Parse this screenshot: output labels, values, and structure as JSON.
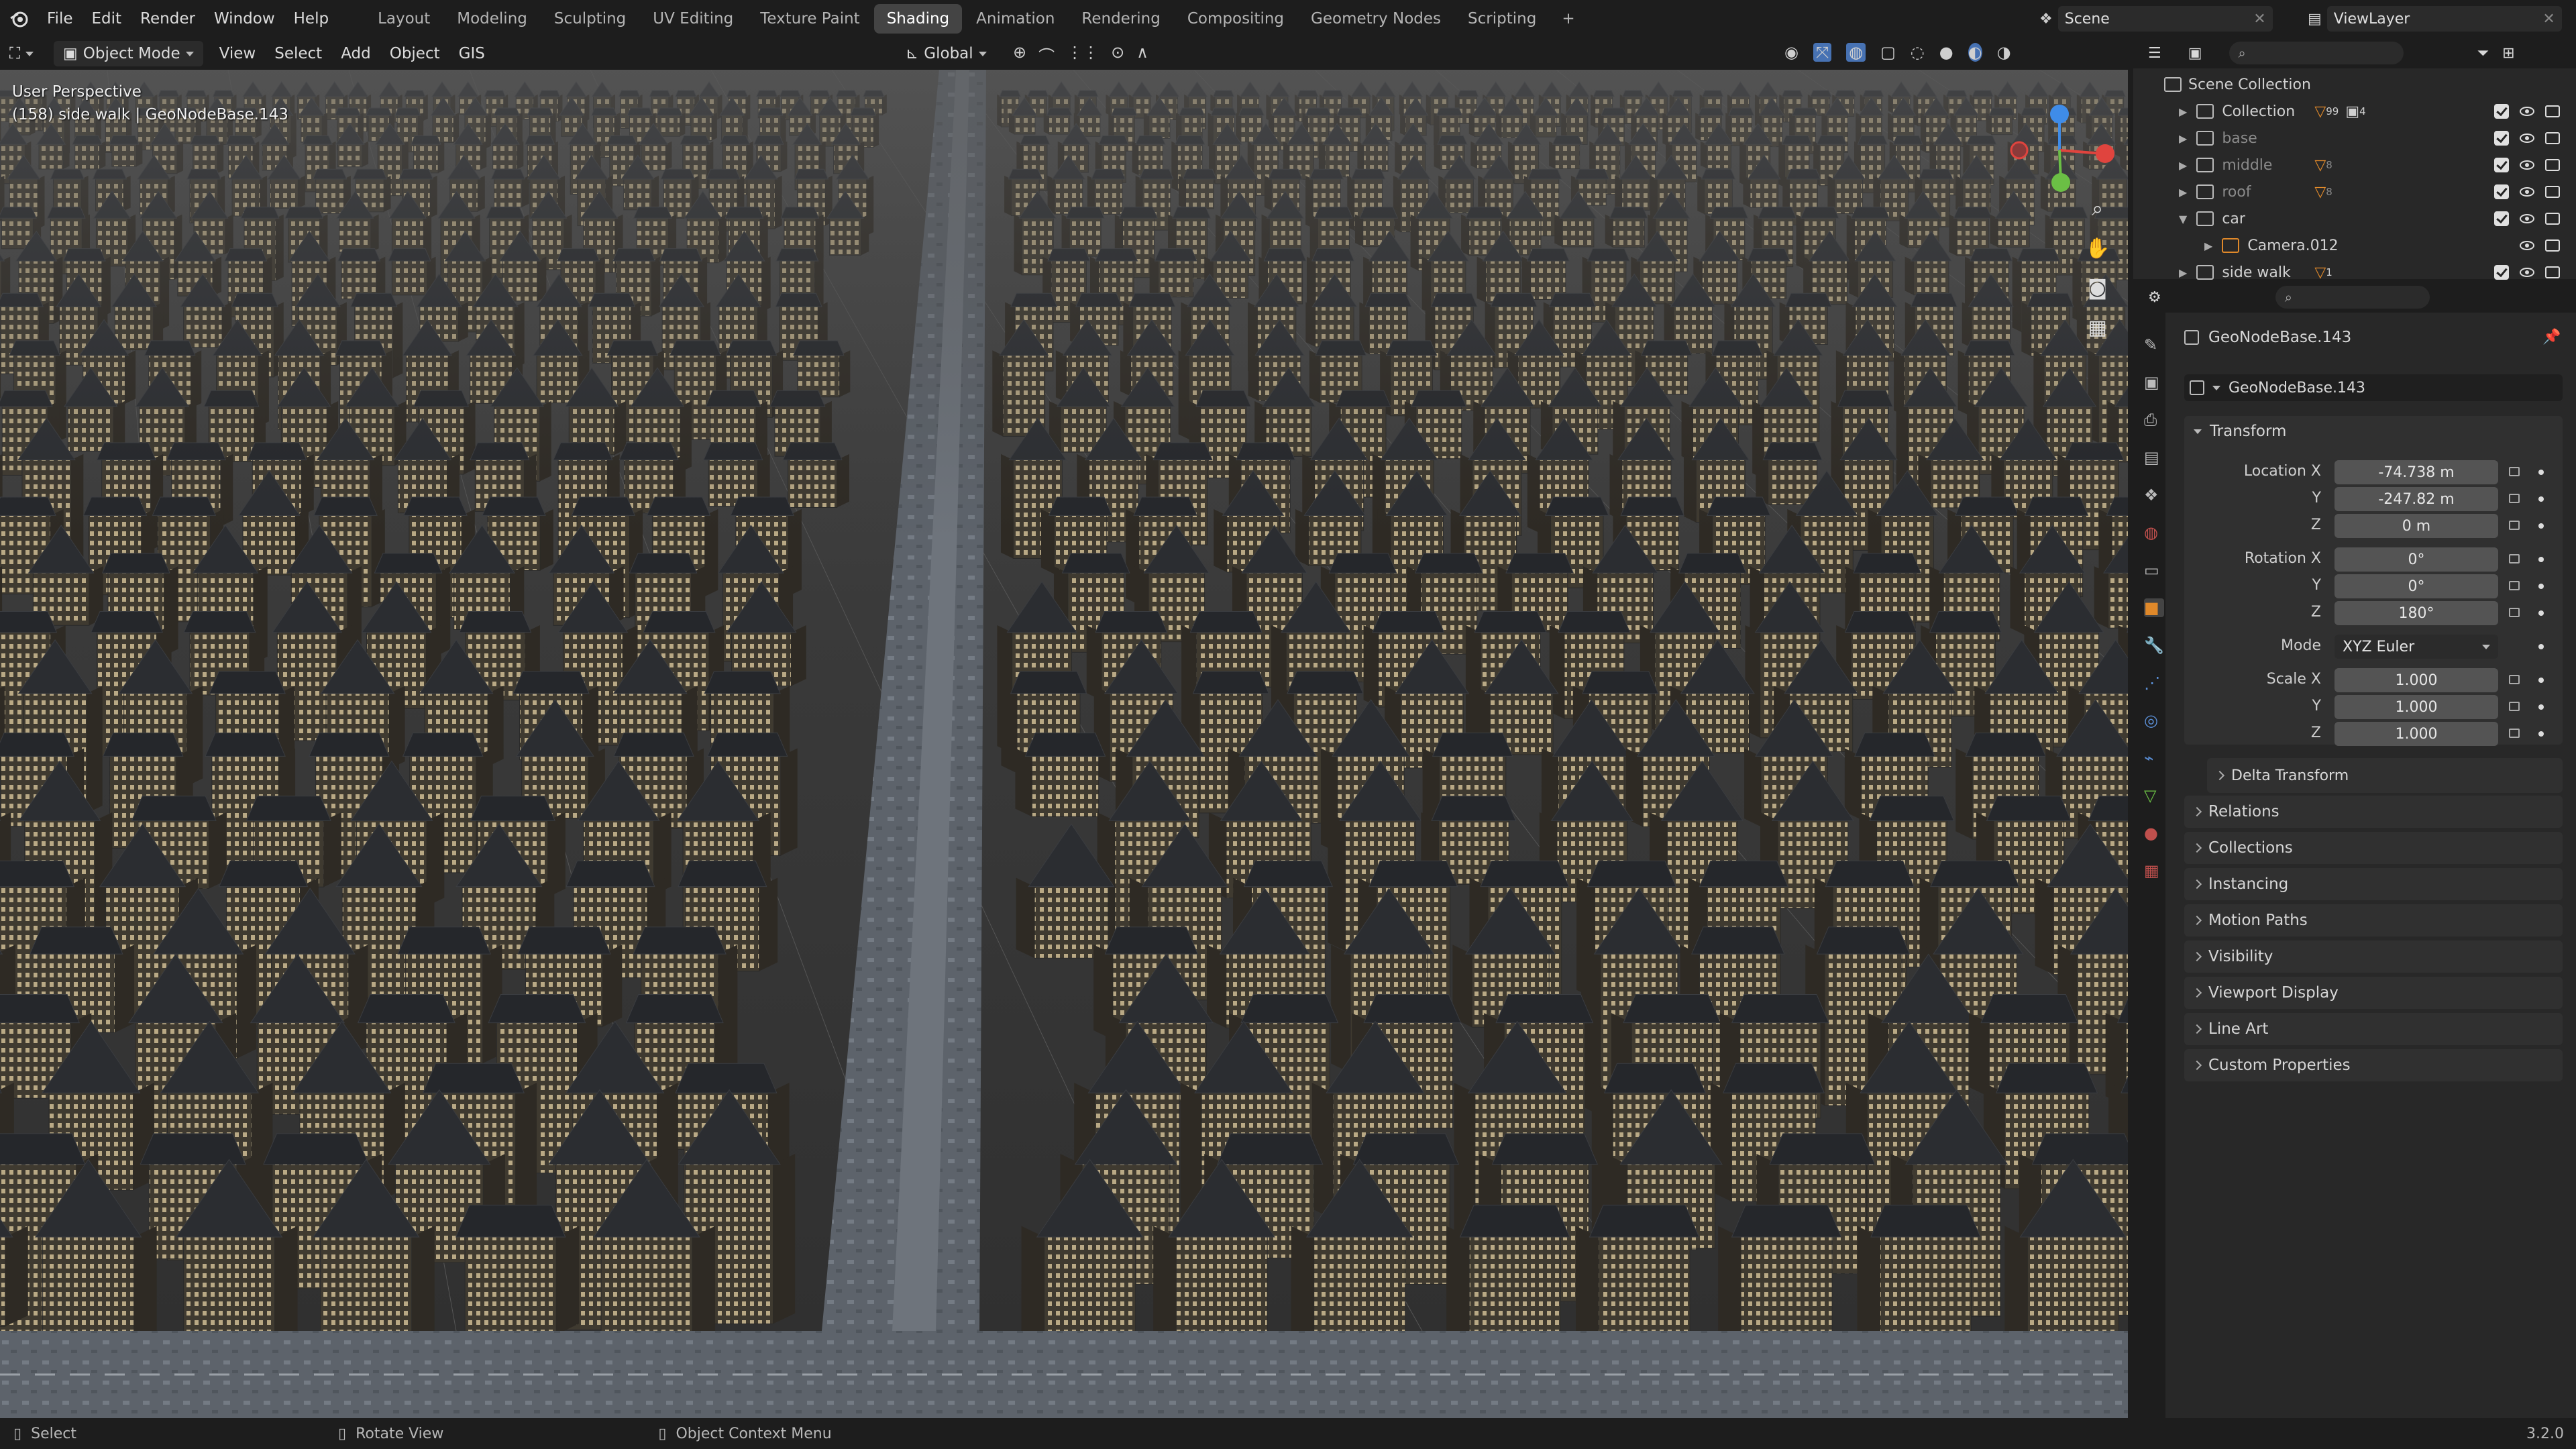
{
  "menu": [
    "File",
    "Edit",
    "Render",
    "Window",
    "Help"
  ],
  "workspaces": [
    {
      "label": "Layout",
      "active": false
    },
    {
      "label": "Modeling",
      "active": false
    },
    {
      "label": "Sculpting",
      "active": false
    },
    {
      "label": "UV Editing",
      "active": false
    },
    {
      "label": "Texture Paint",
      "active": false
    },
    {
      "label": "Shading",
      "active": true
    },
    {
      "label": "Animation",
      "active": false
    },
    {
      "label": "Rendering",
      "active": false
    },
    {
      "label": "Compositing",
      "active": false
    },
    {
      "label": "Geometry Nodes",
      "active": false
    },
    {
      "label": "Scripting",
      "active": false
    }
  ],
  "add_workspace": "+",
  "scene": {
    "name": "Scene",
    "view_layer": "ViewLayer"
  },
  "viewport_header": {
    "mode": "Object Mode",
    "menus": [
      "View",
      "Select",
      "Add",
      "Object",
      "GIS"
    ],
    "orientation": "Global"
  },
  "viewport": {
    "perspective": "User Perspective",
    "object_info": "(158) side walk | GeoNodeBase.143"
  },
  "outliner": {
    "root": "Scene Collection",
    "rows": [
      {
        "label": "Collection",
        "badge": "99",
        "badge2": "4",
        "visible": true
      },
      {
        "label": "base",
        "badge": "",
        "visible": false
      },
      {
        "label": "middle",
        "badge": "8",
        "visible": false
      },
      {
        "label": "roof",
        "badge": "8",
        "visible": false
      },
      {
        "label": "car",
        "badge": "",
        "visible": true
      },
      {
        "label": "Camera.012",
        "badge": "",
        "visible": true
      },
      {
        "label": "side walk",
        "badge": "1",
        "visible": true
      }
    ]
  },
  "properties": {
    "object_name": "GeoNodeBase.143",
    "data_name": "GeoNodeBase.143",
    "transform_label": "Transform",
    "location": {
      "label": "Location X",
      "x": "-74.738 m",
      "y": "-247.82 m",
      "z": "0 m"
    },
    "rotation": {
      "label": "Rotation X",
      "x": "0°",
      "y": "0°",
      "z": "180°"
    },
    "mode_label": "Mode",
    "mode": "XYZ Euler",
    "scale": {
      "label": "Scale X",
      "x": "1.000",
      "y": "1.000",
      "z": "1.000"
    },
    "axis_y": "Y",
    "axis_z": "Z",
    "delta_transform": "Delta Transform",
    "panels": [
      "Relations",
      "Collections",
      "Instancing",
      "Motion Paths",
      "Visibility",
      "Viewport Display",
      "Line Art",
      "Custom Properties"
    ]
  },
  "statusbar": {
    "select": "Select",
    "rotate": "Rotate View",
    "context": "Object Context Menu",
    "version": "3.2.0"
  },
  "colors": {
    "accent": "#4772b3",
    "active_tab": "#444444",
    "panel_bg": "#282828",
    "x_axis": "#e0443e",
    "y_axis": "#6bbf45",
    "z_axis": "#3f8ce8"
  }
}
